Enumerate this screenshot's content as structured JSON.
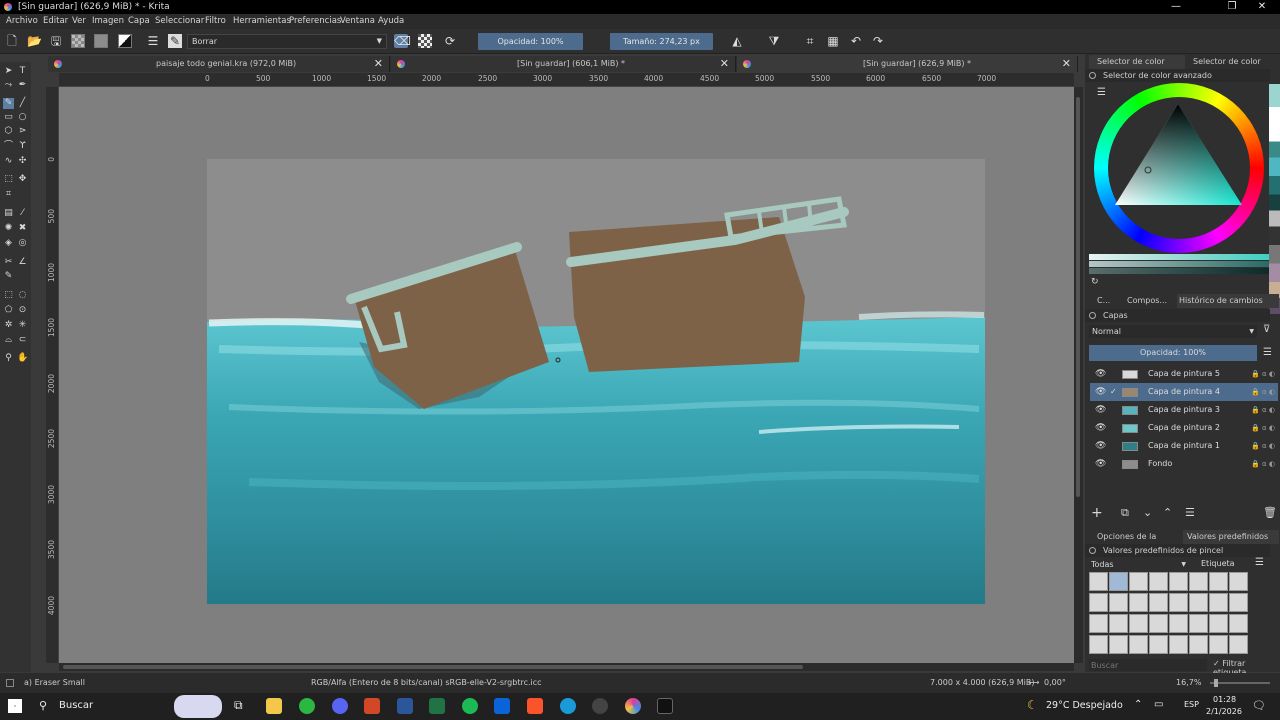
{
  "window": {
    "title": "[Sin guardar]  (626,9 MiB) * - Krita"
  },
  "menu": [
    "Archivo",
    "Editar",
    "Ver",
    "Imagen",
    "Capa",
    "Seleccionar",
    "Filtro",
    "Herramientas",
    "Preferencias",
    "Ventana",
    "Ayuda"
  ],
  "toolbar": {
    "preset_name": "Borrar",
    "opacity": "Opacidad: 100%",
    "size": "Tamaño: 274,23 px"
  },
  "tabs": [
    {
      "label": "paisaje todo genial.kra (972,0 MiB)"
    },
    {
      "label": "[Sin guardar]  (606,1 MiB) *"
    },
    {
      "label": "[Sin guardar]  (626,9 MiB) *"
    }
  ],
  "ruler": {
    "h": [
      "0",
      "500",
      "1000",
      "1500",
      "2000",
      "2500",
      "3000",
      "3500",
      "4000",
      "4500",
      "5000",
      "5500",
      "6000",
      "6500",
      "7000"
    ],
    "v": [
      "0",
      "500",
      "1000",
      "1500",
      "2000",
      "2500",
      "3000",
      "3500",
      "4000"
    ]
  },
  "right_panel": {
    "top_tabs": [
      "Selector de color ava...",
      "Selector de color esp..."
    ],
    "color_title": "Selector de color avanzado",
    "mid_tabs": [
      "C...",
      "Compos...",
      "Histórico de cambios des..."
    ],
    "layers_title": "Capas",
    "blend_mode": "Normal",
    "layer_opacity": "Opacidad:  100%",
    "layers": [
      {
        "name": "Capa de pintura 5",
        "selected": false
      },
      {
        "name": "Capa de pintura 4",
        "selected": true
      },
      {
        "name": "Capa de pintura 3",
        "selected": false
      },
      {
        "name": "Capa de pintura 2",
        "selected": false
      },
      {
        "name": "Capa de pintura 1",
        "selected": false
      },
      {
        "name": "Fondo",
        "selected": false
      }
    ],
    "bottom_tabs": [
      "Opciones de la herr...",
      "Valores predefinidos d..."
    ],
    "presets_title": "Valores predefinidos de pincel",
    "presets_filter": "Todas",
    "tag_label": "Etiqueta",
    "search_placeholder": "Buscar",
    "filter_tag_label": "Filtrar etiqueta"
  },
  "status": {
    "brush": "a) Eraser Small",
    "colorspace": "RGB/Alfa (Entero de 8 bits/canal)  sRGB-elle-V2-srgbtrc.icc",
    "dims": "7.000 x 4.000 (626,9 MiB)",
    "rotation": "0,00°",
    "zoom": "16,7%"
  },
  "taskbar": {
    "search": "Buscar",
    "weather": "29°C  Despejado",
    "lang": "ESP",
    "time": "01:28",
    "date": "2/1/2026"
  },
  "colors": {
    "accent": "#4d6b8c",
    "water": "#3aa3b0",
    "boat": "#7d6248"
  }
}
